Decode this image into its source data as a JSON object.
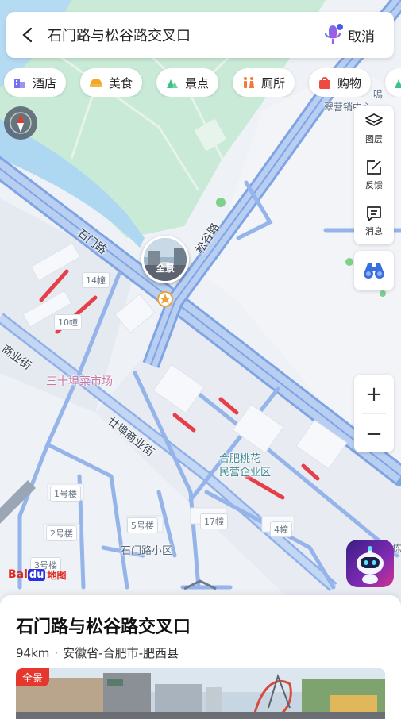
{
  "search": {
    "query": "石门路与松谷路交叉口",
    "cancel_label": "取消"
  },
  "categories": [
    {
      "label": "酒店",
      "icon": "hotel-icon"
    },
    {
      "label": "美食",
      "icon": "food-icon"
    },
    {
      "label": "景点",
      "icon": "scenic-icon"
    },
    {
      "label": "厕所",
      "icon": "toilet-icon"
    },
    {
      "label": "购物",
      "icon": "shopping-icon"
    }
  ],
  "toolbar": {
    "layers_label": "图层",
    "feedback_label": "反馈",
    "messages_label": "消息"
  },
  "zoom": {
    "in_label": "+",
    "out_label": "−"
  },
  "map": {
    "labels": {
      "shimen_road": "石门路",
      "songgu_road": "松谷路",
      "pano": "全景",
      "bldg_14": "14幢",
      "bldg_10": "10幢",
      "shangye_jie": "商业街",
      "market": "三十埠菜市场",
      "sanshibu_street": "廿埠商业街",
      "park_name": "合肥桃花\n民营企业区",
      "bldg_1": "1号楼",
      "bldg_2": "2号楼",
      "bldg_3": "3号楼",
      "bldg_5": "5号楼",
      "bldg_17": "17幢",
      "bldg_4": "4幢",
      "community": "石门路小区",
      "top_right_poi": "翠营销中心",
      "top_right_poi2": "嗚",
      "right_edge": "栋"
    }
  },
  "logo": {
    "text1": "Bai",
    "text2": "du",
    "text3": "地图"
  },
  "place": {
    "title": "石门路与松谷路交叉口",
    "distance": "94km",
    "separator": "·",
    "region": "安徽省-合肥市-肥西县",
    "photo_tag": "全景"
  },
  "colors": {
    "road": "#a9c4ef",
    "road_edge": "#7fa4e4",
    "water": "#aed7f2",
    "park": "#c6ebd4",
    "congestion": "#e5404a",
    "accent": "#3a6fe0"
  }
}
